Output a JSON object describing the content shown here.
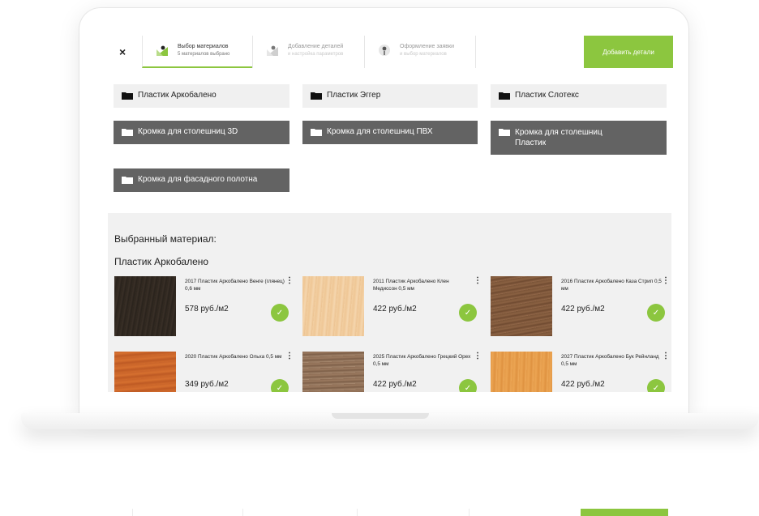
{
  "header": {
    "close_label": "×",
    "steps": [
      {
        "title": "Выбор материалов",
        "sub": "5 материалов выбрано"
      },
      {
        "title": "Добавление деталей",
        "sub": "и настройка параметров"
      },
      {
        "title": "Оформление заявки",
        "sub": "и выбор материалов"
      }
    ],
    "add_button_label": "Добавить детали"
  },
  "folders": [
    "Пластик Аркобалено",
    "Пластик Эггер",
    "Пластик Слотекс",
    "Кромка для столешниц 3D",
    "Кромка для столешниц ПВХ",
    "Кромка для столешниц Пластик",
    "Кромка для фасадного полотна"
  ],
  "selected": {
    "heading": "Выбранный материал:",
    "group_title": "Пластик Аркобалено",
    "check_mark": "✓",
    "menu_glyph": "⋮",
    "cards": [
      {
        "name": "2017 Пластик Аркобалено Венге (глянец) 0,6 мм",
        "price": "578 руб./м2",
        "swatch": "dark-wenge"
      },
      {
        "name": "2011 Пластик Аркобалено Клен Медиссон 0,5 мм",
        "price": "422 руб./м2",
        "swatch": "light-maple"
      },
      {
        "name": "2016 Пластик Аркобалено Каза Стрип 0,5 мм",
        "price": "422 руб./м2",
        "swatch": "brown-oak"
      },
      {
        "name": "2020 Пластик Аркобалено Ольха 0,5 мм",
        "price": "349 руб./м2",
        "swatch": "orange-alder"
      },
      {
        "name": "2025 Пластик Аркобалено Грецкий Орех 0,5 мм",
        "price": "422 руб./м2",
        "swatch": "walnut"
      },
      {
        "name": "2027 Пластик Аркобалено Бук Рейнланд 0,5 мм",
        "price": "422 руб./м2",
        "swatch": "beech"
      }
    ]
  },
  "colors": {
    "accent": "#8cc63f",
    "folder_dark": "#636363",
    "folder_light": "#f0f0f0",
    "panel": "#f1f1f1"
  }
}
